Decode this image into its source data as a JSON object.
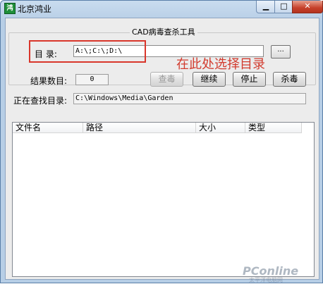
{
  "window": {
    "title": "北京鸿业",
    "icon": "app-logo-icon",
    "controls": {
      "minimize": "▁",
      "maximize": "□",
      "close": "✕"
    }
  },
  "group": {
    "title": "CAD病毒查杀工具"
  },
  "directory": {
    "label": "目 录:",
    "value": "A:\\;C:\\;D:\\",
    "browse_label": "..."
  },
  "annotation": {
    "text": "在此处选择目录",
    "color": "#d23b2e"
  },
  "results": {
    "label": "结果数目:",
    "value": "0"
  },
  "buttons": {
    "query": "查毒",
    "continue": "继续",
    "stop": "停止",
    "kill": "杀毒"
  },
  "current": {
    "label": "正在查找目录:",
    "value": "C:\\Windows\\Media\\Garden"
  },
  "table": {
    "columns": [
      "文件名",
      "路径",
      "大小",
      "类型"
    ],
    "rows": []
  },
  "watermark": {
    "brand": "PConline",
    "sub": "太平洋电脑网"
  }
}
